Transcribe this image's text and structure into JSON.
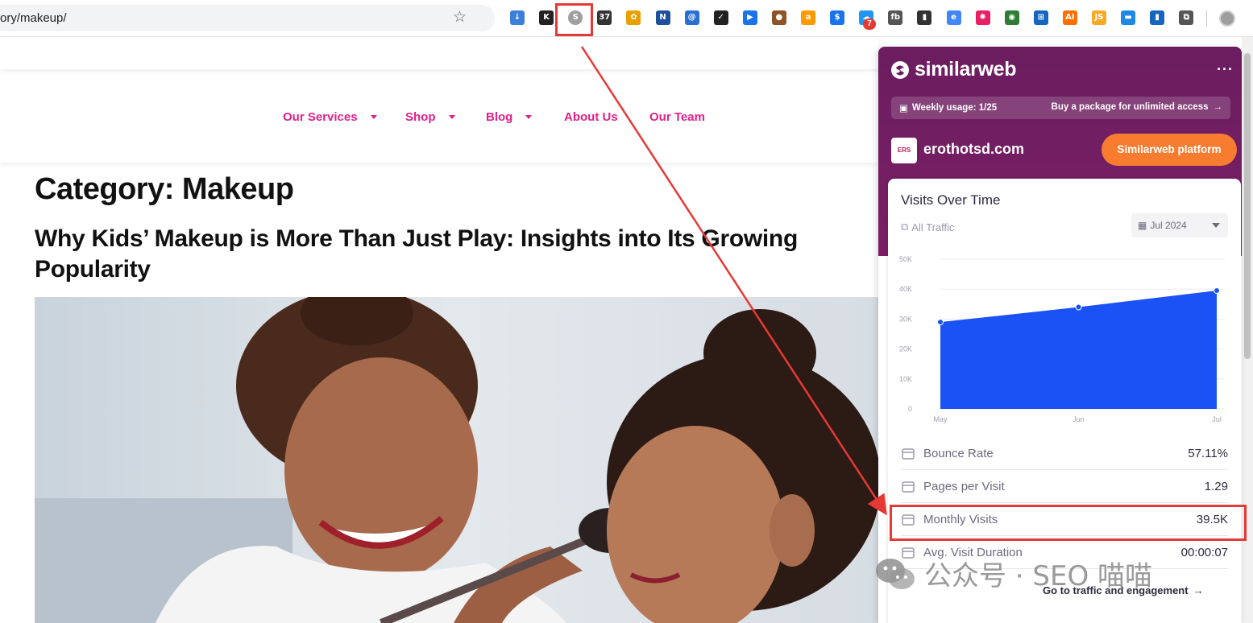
{
  "browser": {
    "url_text": "ory/makeup/",
    "extension_badge": "7",
    "extension_icons": [
      "download-icon",
      "k-icon",
      "similarweb-icon",
      "calendar-icon",
      "sparkle-icon",
      "n-icon",
      "at-icon",
      "check-icon",
      "play-icon",
      "cookie-icon",
      "amazon-icon",
      "s-icon",
      "cloud-icon",
      "fb-icon",
      "contact-icon",
      "edge-icon",
      "color-wheel-icon",
      "glasses-icon",
      "translate-icon",
      "ai-icon",
      "js-icon",
      "tag-icon",
      "bar-chart-icon",
      "puzzle-icon"
    ]
  },
  "site": {
    "nav": [
      {
        "label": "Our Services",
        "dropdown": true
      },
      {
        "label": "Shop",
        "dropdown": true
      },
      {
        "label": "Blog",
        "dropdown": true
      },
      {
        "label": "About Us",
        "dropdown": false
      },
      {
        "label": "Our Team",
        "dropdown": false
      }
    ],
    "heading": "Category: Makeup",
    "post_title": "Why Kids’ Makeup is More Than Just Play: Insights into Its Growing Popularity"
  },
  "similarweb": {
    "brand": "similarweb",
    "more": "···",
    "usage": "Weekly usage: 1/25",
    "buy": "Buy a package for unlimited access",
    "domain": "erothotsd.com",
    "site_logo_text": "ERS",
    "platform_button": "Similarweb platform",
    "card_title": "Visits Over Time",
    "traffic_filter": "All Traffic",
    "date": "Jul 2024",
    "metrics": [
      {
        "label": "Bounce Rate",
        "value": "57.11%",
        "icon": "bounce-icon"
      },
      {
        "label": "Pages per Visit",
        "value": "1.29",
        "icon": "pages-icon"
      },
      {
        "label": "Monthly Visits",
        "value": "39.5K",
        "icon": "calendar-icon"
      },
      {
        "label": "Avg. Visit Duration",
        "value": "00:00:07",
        "icon": "clock-icon"
      }
    ],
    "go_link": "Go to traffic and engagement",
    "accent": "#1b52f5",
    "header_color": "#6b1d5f",
    "button_color": "#f87c30"
  },
  "watermark": "公众号 · SEO 喵喵",
  "chart_data": {
    "type": "area",
    "categories": [
      "May",
      "Jun",
      "Jul"
    ],
    "values": [
      29000,
      34000,
      39500
    ],
    "y_ticks": [
      "0",
      "10K",
      "20K",
      "30K",
      "40K",
      "50K"
    ],
    "ylim": [
      0,
      50000
    ],
    "grid": true
  }
}
